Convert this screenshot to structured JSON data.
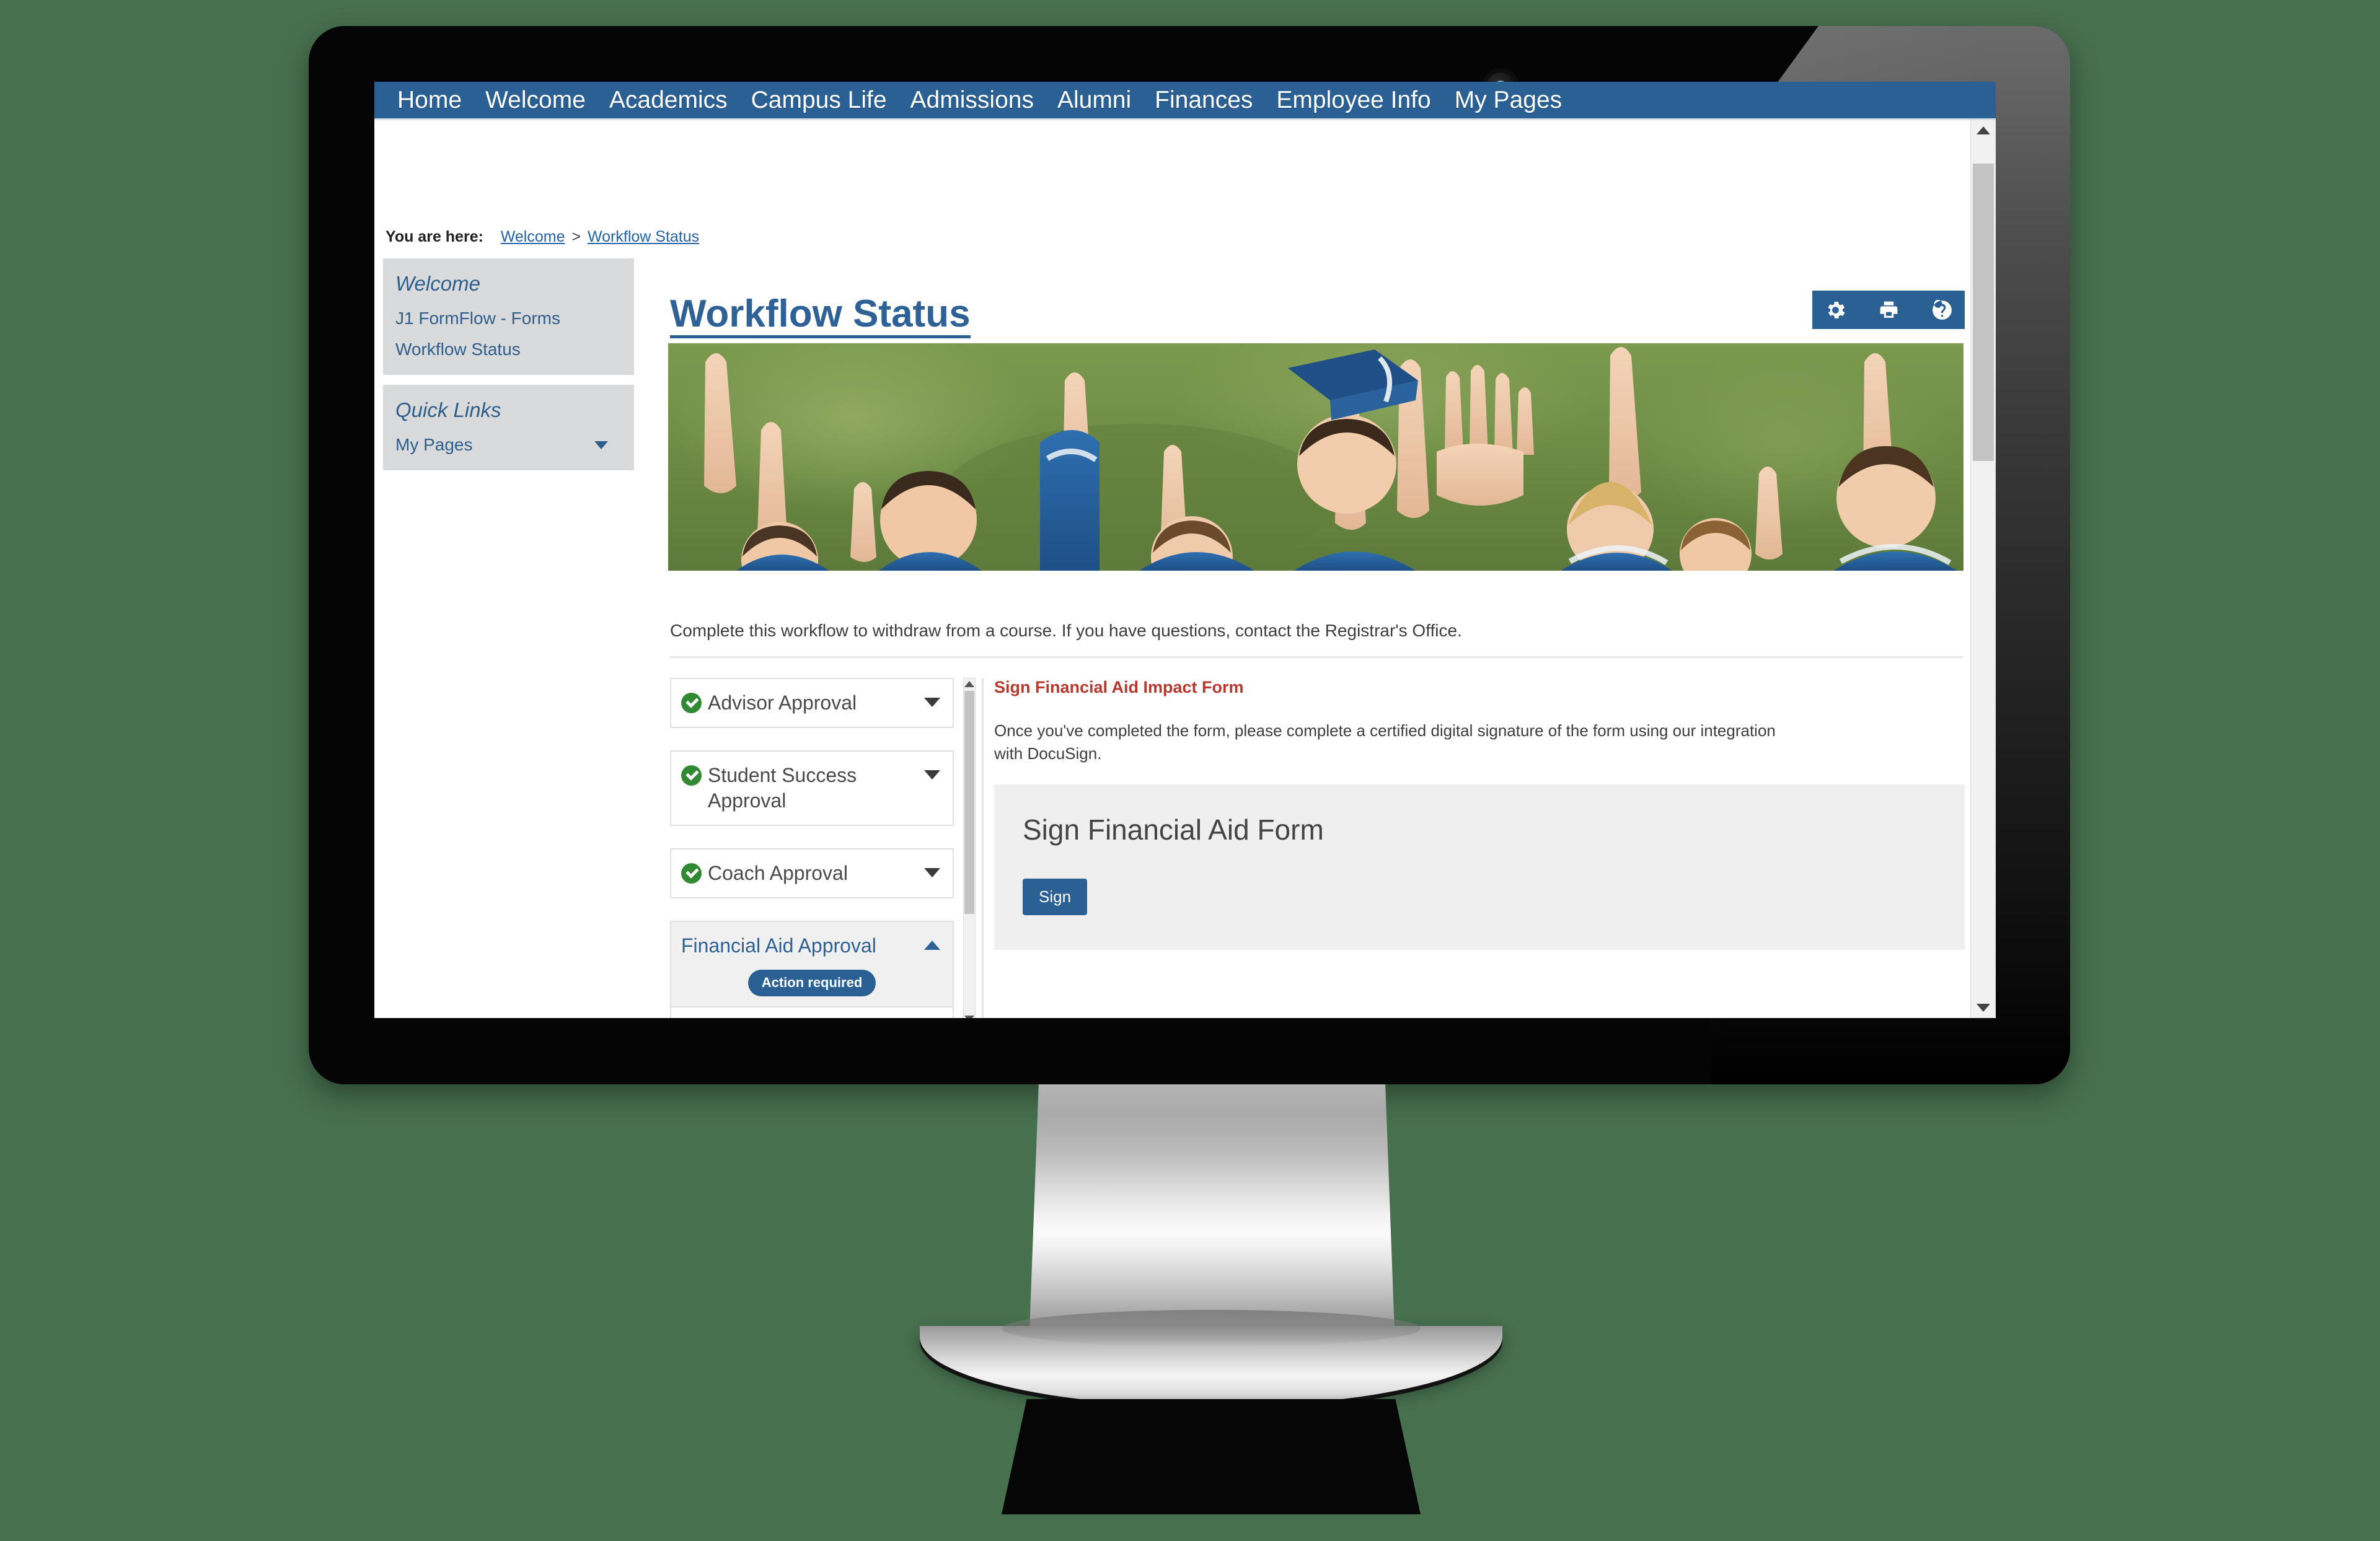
{
  "topnav": {
    "items": [
      {
        "label": "Home"
      },
      {
        "label": "Welcome"
      },
      {
        "label": "Academics"
      },
      {
        "label": "Campus Life"
      },
      {
        "label": "Admissions"
      },
      {
        "label": "Alumni"
      },
      {
        "label": "Finances"
      },
      {
        "label": "Employee Info"
      },
      {
        "label": "My Pages"
      }
    ]
  },
  "breadcrumb": {
    "label": "You are here:",
    "crumb1": "Welcome",
    "separator": ">",
    "crumb2": "Workflow Status"
  },
  "sidebar": {
    "group1": {
      "heading": "Welcome",
      "links": [
        {
          "label": "J1 FormFlow - Forms"
        },
        {
          "label": "Workflow Status"
        }
      ]
    },
    "group2": {
      "heading": "Quick Links",
      "links": [
        {
          "label": "My Pages",
          "icon": "chevron-down-icon"
        }
      ]
    }
  },
  "page": {
    "title": "Workflow Status",
    "intro": "Complete this workflow to withdraw from a course. If you have questions, contact the Registrar's Office.",
    "banner_alt": "Graduating students in blue gowns throwing caps in the air on a green field"
  },
  "page_tools": [
    {
      "name": "gear-icon",
      "title": "Settings"
    },
    {
      "name": "print-icon",
      "title": "Print"
    },
    {
      "name": "help-icon",
      "title": "Help"
    }
  ],
  "accordion": {
    "items": [
      {
        "title": "Advisor Approval",
        "status_icon": "check-circle-icon",
        "state": "collapsed",
        "chevron": "chevron-down-icon"
      },
      {
        "title": "Student Success Approval",
        "status_icon": "check-circle-icon",
        "state": "collapsed",
        "chevron": "chevron-down-icon"
      },
      {
        "title": "Coach Approval",
        "status_icon": "check-circle-icon",
        "state": "collapsed",
        "chevron": "chevron-down-icon"
      },
      {
        "title": "Financial Aid Approval",
        "status_icon": null,
        "state": "expanded",
        "chevron": "chevron-up-icon",
        "badge": "Action required"
      }
    ]
  },
  "right_panel": {
    "heading": "Sign Financial Aid Impact Form",
    "body": "Once you've completed the form, please complete a certified digital signature of the form using our integration with DocuSign.",
    "form_box": {
      "title": "Sign Financial Aid Form",
      "button": "Sign"
    }
  },
  "colors": {
    "brand_blue": "#2a6094",
    "link_blue": "#2e6296",
    "heading_red": "#b7392e",
    "status_green": "#2f8a32",
    "sidebar_grey": "#d9dadc",
    "page_background": "#47704f"
  }
}
